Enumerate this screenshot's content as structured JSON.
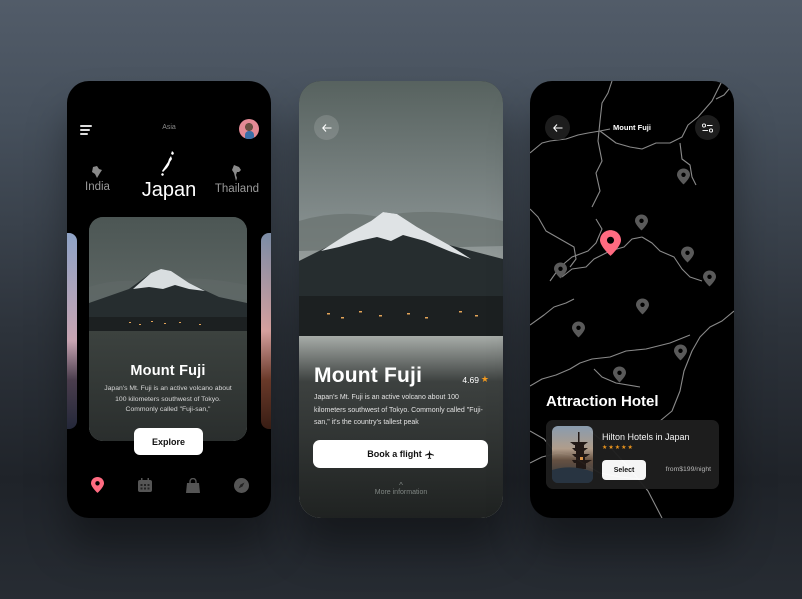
{
  "screen1": {
    "region": "Asia",
    "countries": [
      {
        "name": "India"
      },
      {
        "name": "Japan"
      },
      {
        "name": "Thailand"
      }
    ],
    "card": {
      "title": "Mount Fuji",
      "description": "Japan's Mt. Fuji is an active volcano about 100 kilometers southwest of Tokyo. Commonly called \"Fuji-san,\"",
      "button": "Explore"
    },
    "tabbar": [
      {
        "icon": "map-pin-icon",
        "active": true
      },
      {
        "icon": "calendar-icon",
        "active": false
      },
      {
        "icon": "shopping-bag-icon",
        "active": false
      },
      {
        "icon": "compass-icon",
        "active": false
      }
    ],
    "accent_color": "#ff6b81"
  },
  "screen2": {
    "title": "Mount Fuji",
    "rating": "4.69",
    "description": "Japan's Mt. Fuji is an active volcano about 100 kilometers southwest of Tokyo. Commonly called \"Fuji-san,\" it's the country's tallest peak",
    "book_button": "Book a flight",
    "more_info": "More information",
    "star_color": "#f39a1f"
  },
  "screen3": {
    "map_title": "Mount Fuji",
    "section_title": "Attraction Hotel",
    "hotel": {
      "name": "Hilton Hotels in Japan",
      "stars": 5,
      "star_text": "★★★★★",
      "select_button": "Select",
      "price": "from$199/night"
    },
    "pin_color": "#ff6b81",
    "inactive_pin_color": "#5a5a5a"
  }
}
